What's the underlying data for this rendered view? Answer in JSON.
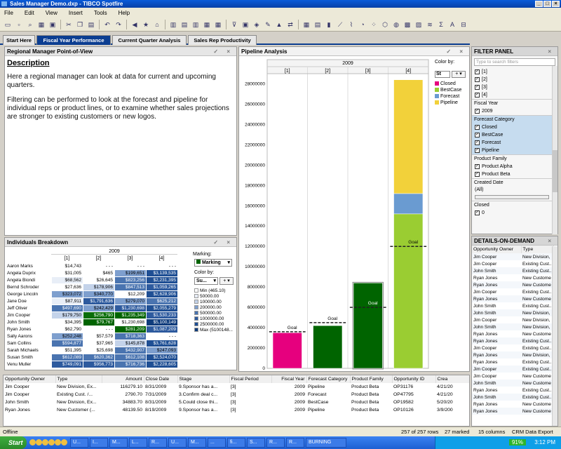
{
  "window": {
    "title": "Sales Manager Demo.dxp - TIBCO Spotfire",
    "controls": [
      "_",
      "□",
      "×"
    ]
  },
  "menu": [
    "File",
    "Edit",
    "View",
    "Insert",
    "Tools",
    "Help"
  ],
  "tabs": [
    {
      "label": "Start Here",
      "active": false
    },
    {
      "label": "Fiscal Year Performance",
      "active": true
    },
    {
      "label": "Current Quarter Analysis",
      "active": false
    },
    {
      "label": "Sales Rep Productivity",
      "active": false
    }
  ],
  "regional": {
    "title": "Regional Manager Point-of-View",
    "heading": "Description",
    "p1": "Here a regional manager can look at data for current and upcoming quarters.",
    "p2": "Filtering can be performed to look at the forecast and pipeline for individual reps or product lines, or to examine whether sales projections are stronger to existing customers or new logos."
  },
  "individuals": {
    "title": "Individuals Breakdown",
    "year": "2009",
    "columns": [
      "[1]",
      "[2]",
      "[3]",
      "[4]"
    ],
    "rows": [
      {
        "name": "Aaron Marks",
        "v": [
          "$14,743",
          "- - -",
          "- - -",
          "- - -"
        ],
        "c": [
          "#ffffff",
          "#ffffff",
          "#ffffff",
          "#ffffff"
        ]
      },
      {
        "name": "Angela Duprix",
        "v": [
          "$31,005",
          "$465",
          "$199,651",
          "$3,139,535"
        ],
        "c": [
          "#ffffff",
          "#ffffff",
          "#7e9fce",
          "#1f4f94"
        ]
      },
      {
        "name": "Angela Biondi",
        "v": [
          "$68,562",
          "$26,645",
          "$823,256",
          "$2,231,395"
        ],
        "c": [
          "#e8eef7",
          "#ffffff",
          "#4a74b0",
          "#1f4f94"
        ]
      },
      {
        "name": "Bernd Schroder",
        "v": [
          "$27,636",
          "$178,906",
          "$847,513",
          "$1,059,265"
        ],
        "c": [
          "#ffffff",
          "#c4d3ea",
          "#4a74b0",
          "#2d5a9e"
        ]
      },
      {
        "name": "George Lincoln",
        "v": [
          "$323,072",
          "$340,770",
          "$12,209",
          "$2,628,906"
        ],
        "c": [
          "#7e9fce",
          "#7e9fce",
          "#ffffff",
          "#1f4f94"
        ]
      },
      {
        "name": "Jane Doe",
        "v": [
          "$87,911",
          "$1,791,636",
          "$279,070",
          "$625,212"
        ],
        "c": [
          "#e8eef7",
          "#2d5a9e",
          "#7e9fce",
          "#4a74b0"
        ]
      },
      {
        "name": "Jeff Oliver",
        "v": [
          "$497,690",
          "$242,429",
          "$1,230,698",
          "$2,055,279"
        ],
        "c": [
          "#4a74b0",
          "#7e9fce",
          "#2d5a9e",
          "#1f4f94"
        ]
      },
      {
        "name": "Jim Cooper",
        "v": [
          "$179,750",
          "$256,790",
          "$1,235,349",
          "$1,530,233"
        ],
        "c": [
          "#c4d3ea",
          "#0a6e0a",
          "#006400",
          "#2d5a9e"
        ]
      },
      {
        "name": "John Smith",
        "v": [
          "$34,395",
          "$79,767",
          "$1,230,698",
          "$5,100,149"
        ],
        "c": [
          "#ffffff",
          "#006400",
          "#ffffff",
          "#0f3c7c"
        ]
      },
      {
        "name": "Ryan Jones",
        "v": [
          "$62,790",
          "- - -",
          "$281,209",
          "$1,087,209"
        ],
        "c": [
          "#ffffff",
          "#ffffff",
          "#006400",
          "#2d5a9e"
        ]
      },
      {
        "name": "Sally Aarons",
        "v": [
          "$252,248",
          "$57,579",
          "$718,363",
          "- - -"
        ],
        "c": [
          "#7e9fce",
          "#ffffff",
          "#4a74b0",
          "#ffffff"
        ]
      },
      {
        "name": "Sam Collins",
        "v": [
          "$594,877",
          "$37,965",
          "$145,878",
          "$3,761,628"
        ],
        "c": [
          "#4a74b0",
          "#ffffff",
          "#c4d3ea",
          "#1f4f94"
        ]
      },
      {
        "name": "Sarah Michaels",
        "v": [
          "$51,395",
          "$25,698",
          "$432,907",
          "$247,093"
        ],
        "c": [
          "#ffffff",
          "#ffffff",
          "#4a74b0",
          "#7e9fce"
        ]
      },
      {
        "name": "Susan Smith",
        "v": [
          "$612,089",
          "$620,362",
          "$612,108",
          "$2,524,070"
        ],
        "c": [
          "#4a74b0",
          "#4a74b0",
          "#4a74b0",
          "#1f4f94"
        ]
      },
      {
        "name": "Venu Muller",
        "v": [
          "$749,091",
          "$956,773",
          "$716,736",
          "$2,228,605"
        ],
        "c": [
          "#2d5a9e",
          "#2d5a9e",
          "#4a74b0",
          "#1f4f94"
        ]
      }
    ],
    "marking_label": "Marking:",
    "marking_value": "Marking",
    "colorby_label": "Color by:",
    "colorby_value": "Su...",
    "legend": [
      {
        "label": "Min (465.10)",
        "color": "#ffffff"
      },
      {
        "label": "50000.00",
        "color": "#e8eef7"
      },
      {
        "label": "100000.00",
        "color": "#c4d3ea"
      },
      {
        "label": "200000.00",
        "color": "#7e9fce"
      },
      {
        "label": "500000.00",
        "color": "#4a74b0"
      },
      {
        "label": "1000000.00",
        "color": "#2d5a9e"
      },
      {
        "label": "2500000.00",
        "color": "#1f4f94"
      },
      {
        "label": "Max (5100148...",
        "color": "#0f3c7c"
      }
    ]
  },
  "pipeline": {
    "title": "Pipeline Analysis",
    "colorby_label": "Color by:",
    "colorby_value": "St",
    "legend": [
      {
        "label": "Closed",
        "color": "#e6007e"
      },
      {
        "label": "BestCase",
        "color": "#9acd32"
      },
      {
        "label": "Forecast",
        "color": "#6a9bd1"
      },
      {
        "label": "Pipeline",
        "color": "#f2d13a"
      }
    ]
  },
  "chart_data": {
    "type": "bar",
    "title": "",
    "xlabel": "",
    "ylabel": "",
    "year": "2009",
    "categories": [
      "[1]",
      "[2]",
      "[3]",
      "[4]"
    ],
    "ylim": [
      0,
      29000000
    ],
    "yticks": [
      0,
      2000000,
      4000000,
      6000000,
      8000000,
      10000000,
      12000000,
      14000000,
      16000000,
      18000000,
      20000000,
      22000000,
      24000000,
      26000000,
      28000000
    ],
    "series": [
      {
        "name": "Closed",
        "values": [
          3500000,
          0,
          0,
          0
        ],
        "color": "#e6007e"
      },
      {
        "name": "BestCase",
        "values": [
          0,
          4200000,
          0,
          0
        ],
        "color": "#006400"
      },
      {
        "name": "Forecast",
        "values": [
          0,
          0,
          8400000,
          0
        ],
        "color": "#006400"
      },
      {
        "name": "BestCase",
        "values": [
          0,
          0,
          0,
          15200000
        ],
        "color": "#9acd32"
      },
      {
        "name": "Forecast",
        "values": [
          0,
          0,
          0,
          2000000
        ],
        "color": "#6a9bd1"
      },
      {
        "name": "Pipeline",
        "values": [
          0,
          0,
          0,
          11200000
        ],
        "color": "#f2d13a"
      }
    ],
    "goals": [
      3600000,
      4500000,
      6000000,
      12000000
    ],
    "goal_label": "Goal"
  },
  "filter_panel": {
    "title": "FILTER PANEL",
    "search_placeholder": "Type to search filters",
    "quarters": [
      "[1]",
      "[2]",
      "[3]",
      "[4]"
    ],
    "fiscal_year_label": "Fiscal Year",
    "fiscal_year_values": [
      "2009"
    ],
    "forecast_category_label": "Forecast Category",
    "forecast_category_values": [
      "Closed",
      "BestCase",
      "Forecast",
      "Pipeline"
    ],
    "product_family_label": "Product Family",
    "product_family_values": [
      "Product Alpha",
      "Product Beta"
    ],
    "created_date_label": "Created Date",
    "created_date_value": "(All)",
    "closed_label": "Closed",
    "closed_values": [
      "0"
    ]
  },
  "details": {
    "title": "DETAILS-ON-DEMAND",
    "columns": [
      "Opportunity Owner",
      "Type"
    ],
    "rows": [
      [
        "Jim Cooper",
        "New Division,"
      ],
      [
        "Jim Cooper",
        "Existing Cust..."
      ],
      [
        "John Smith",
        "Existing Cust..."
      ],
      [
        "Ryan Jones",
        "New Custome"
      ],
      [
        "Ryan Jones",
        "New Custome"
      ],
      [
        "Jim Cooper",
        "Existing Cust..."
      ],
      [
        "Ryan Jones",
        "New Custome"
      ],
      [
        "John Smith",
        "Existing Cust..."
      ],
      [
        "John Smith",
        "New Division,"
      ],
      [
        "Jim Cooper",
        "New Division,"
      ],
      [
        "John Smith",
        "New Division,"
      ],
      [
        "Ryan Jones",
        "New Custome"
      ],
      [
        "Ryan Jones",
        "Existing Cust..."
      ],
      [
        "Jim Cooper",
        "Existing Cust..."
      ],
      [
        "Ryan Jones",
        "New Division,"
      ],
      [
        "Ryan Jones",
        "Existing Cust..."
      ],
      [
        "Jim Cooper",
        "Existing Cust..."
      ],
      [
        "Jim Cooper",
        "New Custome"
      ],
      [
        "John Smith",
        "New Custome"
      ],
      [
        "Ryan Jones",
        "Existing Cust..."
      ],
      [
        "John Smith",
        "Existing Cust..."
      ],
      [
        "Ryan Jones",
        "New Custome"
      ],
      [
        "Ryan Jones",
        "New Custome"
      ]
    ]
  },
  "bottom_table": {
    "columns": [
      "Opportunity Owner",
      "Type",
      "Amount",
      "Close Date",
      "Stage",
      "Fiscal Period",
      "Fiscal Year",
      "Forecast Category",
      "Product Family",
      "Opportunity ID",
      "Crea"
    ],
    "rows": [
      [
        "Jim Cooper",
        "New Division, Ex...",
        "116279.10",
        "8/31/2009",
        "9.Sponsor has a...",
        "[3]",
        "2009",
        "Pipeline",
        "Product Beta",
        "OP31176",
        "4/21/20"
      ],
      [
        "Jim Cooper",
        "Existing Cust. /...",
        "2790.70",
        "7/31/2009",
        "3.Confirm deal c...",
        "[3]",
        "2009",
        "Forecast",
        "Product Beta",
        "OP47795",
        "4/21/20"
      ],
      [
        "John Smith",
        "New Division, Ex...",
        "34883.70",
        "8/31/2009",
        "5.Could close thi...",
        "[3]",
        "2009",
        "BestCase",
        "Product Beta",
        "OP19582",
        "5/20/20"
      ],
      [
        "Ryan Jones",
        "New Customer (...",
        "48139.50",
        "8/19/2009",
        "9.Sponsor has a...",
        "[3]",
        "2009",
        "Pipeline",
        "Product Beta",
        "OP10126",
        "3/9/200"
      ]
    ]
  },
  "statusbar": {
    "left": "Offline",
    "rows": "257 of 257 rows",
    "marked": "27 marked",
    "columns": "15 columns",
    "export": "CRM Data Export"
  },
  "taskbar": {
    "start": "Start",
    "tasks": [
      "U...",
      "I...",
      "M...",
      "L...",
      "R...",
      "U...",
      "M...",
      "...",
      "fi...",
      "S...",
      "R...",
      "R...",
      "BURNING TASKS"
    ],
    "battery": "91%",
    "clock": "3:12 PM"
  }
}
